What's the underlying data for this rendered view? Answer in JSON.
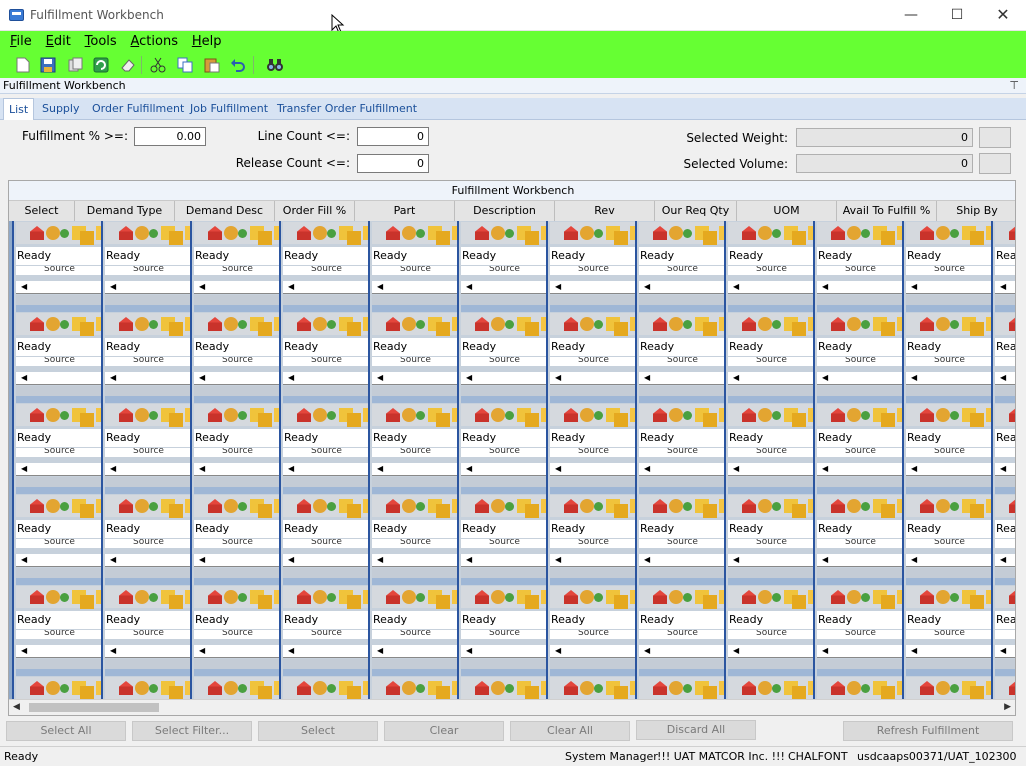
{
  "window": {
    "title": "Fulfillment Workbench",
    "min_label": "—",
    "max_label": "☐",
    "close_label": "✕"
  },
  "menu": {
    "items": [
      {
        "label": "File",
        "accel": "F",
        "rest": "ile"
      },
      {
        "label": "Edit",
        "accel": "E",
        "rest": "dit"
      },
      {
        "label": "Tools",
        "accel": "T",
        "rest": "ools"
      },
      {
        "label": "Actions",
        "accel": "A",
        "rest": "ctions"
      },
      {
        "label": "Help",
        "accel": "H",
        "rest": "elp"
      }
    ]
  },
  "toolbar": {
    "buttons": [
      "new-icon",
      "save-icon",
      "copy-record-icon",
      "refresh-icon",
      "eraser-icon",
      "cut-icon",
      "copy-icon",
      "paste-icon",
      "undo-icon",
      "search-binoculars-icon"
    ]
  },
  "panel": {
    "title": "Fulfillment Workbench",
    "pin": "⊤"
  },
  "tabs": [
    {
      "label": "List",
      "active": true
    },
    {
      "label": "Supply",
      "active": false
    },
    {
      "label": "Order Fulfillment",
      "active": false
    },
    {
      "label": "Job Fulfillment",
      "active": false
    },
    {
      "label": "Transfer Order Fulfillment",
      "active": false
    }
  ],
  "filters": {
    "fulfillment_label": "Fulfillment % >=:",
    "fulfillment_value": "0.00",
    "line_count_label": "Line Count <=:",
    "line_count_value": "0",
    "release_count_label": "Release Count <=:",
    "release_count_value": "0",
    "selected_weight_label": "Selected Weight:",
    "selected_weight_value": "0",
    "selected_volume_label": "Selected Volume:",
    "selected_volume_value": "0"
  },
  "grid": {
    "caption": "Fulfillment Workbench",
    "columns": [
      "Select",
      "Demand Type",
      "Demand Desc",
      "Order Fill %",
      "Part",
      "Description",
      "Rev",
      "Our Req Qty",
      "UOM",
      "Avail To Fulfill %",
      "Ship By"
    ],
    "cell_status": "Ready",
    "cell_source": "Source",
    "cell_status_partial": "Rea"
  },
  "actions": {
    "select_all": "Select All",
    "select_filter": "Select Filter...",
    "select": "Select",
    "clear": "Clear",
    "clear_all": "Clear All",
    "discard_all": "Discard All",
    "refresh_fulfillment": "Refresh Fulfillment"
  },
  "status": {
    "state": "Ready",
    "user": "System Manager",
    "company": "!!! UAT MATCOR Inc. !!!",
    "site": "CHALFONT",
    "server": "usdcaaps00371/UAT_102300"
  }
}
